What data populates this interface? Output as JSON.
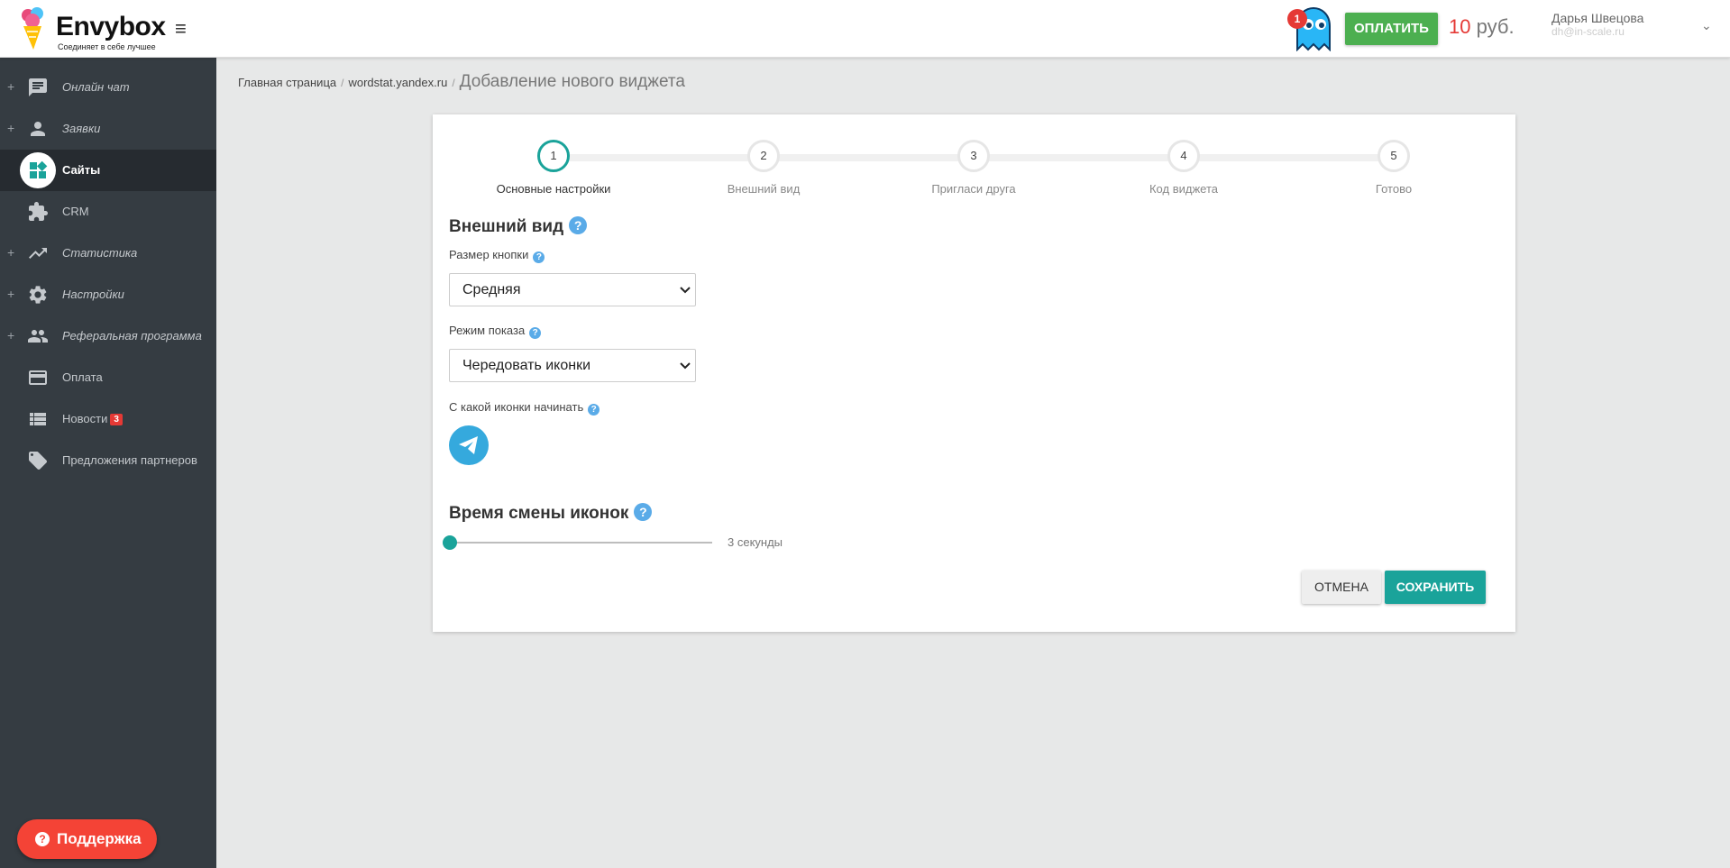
{
  "header": {
    "brand_name": "Envybox",
    "brand_tagline": "Соединяет в себе лучшее",
    "menu_icon": "≡",
    "notifications_count": "1",
    "pay_label": "ОПЛАТИТЬ",
    "balance_amount": "10",
    "balance_currency": "руб.",
    "user_name": "Дарья Швецова",
    "user_email": "dh@in-scale.ru",
    "user_menu_icon": "⌄"
  },
  "sidebar": {
    "items": [
      {
        "plus": "+",
        "label": "Онлайн чат",
        "icon": "chat-icon"
      },
      {
        "plus": "+",
        "label": "Заявки",
        "icon": "person-icon"
      },
      {
        "plus": "",
        "label": "Сайты",
        "icon": "widgets-icon",
        "active": true
      },
      {
        "plus": "",
        "label": "CRM",
        "icon": "puzzle-icon"
      },
      {
        "plus": "+",
        "label": "Статистика",
        "icon": "trending-up-icon"
      },
      {
        "plus": "+",
        "label": "Настройки",
        "icon": "gear-icon"
      },
      {
        "plus": "+",
        "label": "Реферальная программа",
        "icon": "group-icon"
      },
      {
        "plus": "",
        "label": "Оплата",
        "icon": "credit-card-icon"
      },
      {
        "plus": "",
        "label": "Новости",
        "icon": "list-icon",
        "badge": "3"
      },
      {
        "plus": "",
        "label": "Предложения партнеров",
        "icon": "tag-icon"
      }
    ],
    "support_icon": "?",
    "support_label": "Поддержка"
  },
  "breadcrumb": {
    "items": [
      "Главная страница",
      "wordstat.yandex.ru"
    ],
    "separator": "/",
    "current": "Добавление нового виджета"
  },
  "stepper": {
    "steps": [
      {
        "number": "1",
        "label": "Основные настройки",
        "active": true
      },
      {
        "number": "2",
        "label": "Внешний вид"
      },
      {
        "number": "3",
        "label": "Пригласи друга"
      },
      {
        "number": "4",
        "label": "Код виджета"
      },
      {
        "number": "5",
        "label": "Готово"
      }
    ]
  },
  "form": {
    "help_icon": "?",
    "appearance_title": "Внешний вид",
    "button_size_label": "Размер кнопки",
    "button_size_value": "Средняя",
    "display_mode_label": "Режим показа",
    "display_mode_value": "Чередовать иконки",
    "start_icon_label": "С какой иконки начинать",
    "start_icon": "telegram-icon",
    "switch_time_title": "Время смены иконок",
    "switch_time_value": "3 секунды",
    "switch_time_level": 0,
    "cancel_label": "ОТМЕНА",
    "save_label": "СОХРАНИТЬ"
  },
  "colors": {
    "accent": "#1aa39a",
    "pay_green": "#4caf50",
    "danger": "#e53935",
    "sidebar_bg": "#353c42",
    "help_blue": "#5aabe8",
    "telegram": "#35a9dd"
  }
}
